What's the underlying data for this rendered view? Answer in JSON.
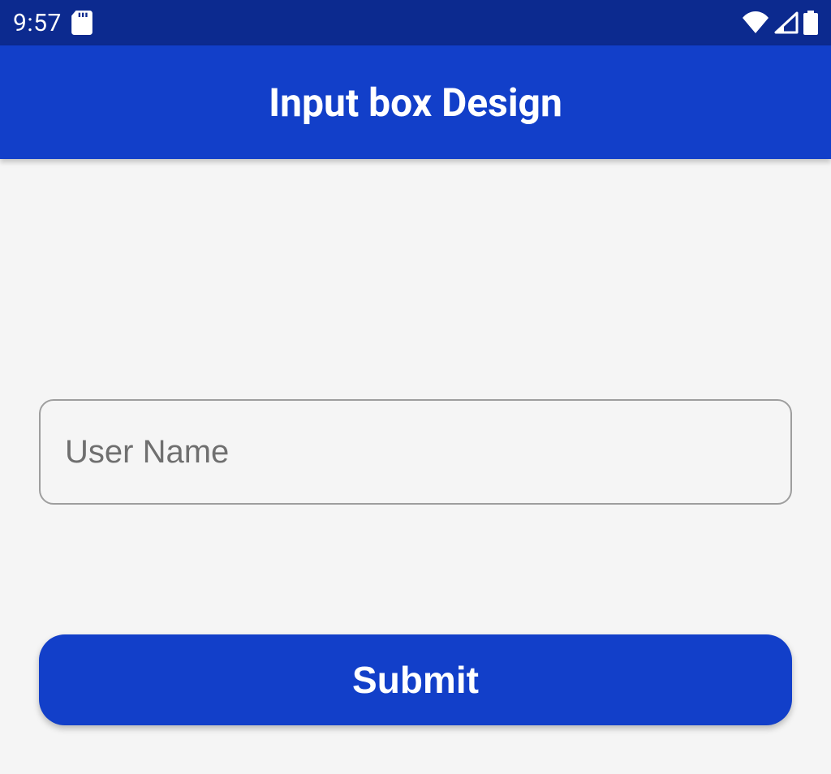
{
  "status_bar": {
    "time": "9:57"
  },
  "app_bar": {
    "title": "Input box Design"
  },
  "form": {
    "username_placeholder": "User Name",
    "username_value": "",
    "submit_label": "Submit"
  },
  "colors": {
    "status_bar_bg": "#0c2a8f",
    "app_bar_bg": "#123fc9",
    "button_bg": "#123fc9",
    "page_bg": "#f5f5f5",
    "input_border": "#9e9e9e",
    "placeholder": "#6f6f6f"
  }
}
